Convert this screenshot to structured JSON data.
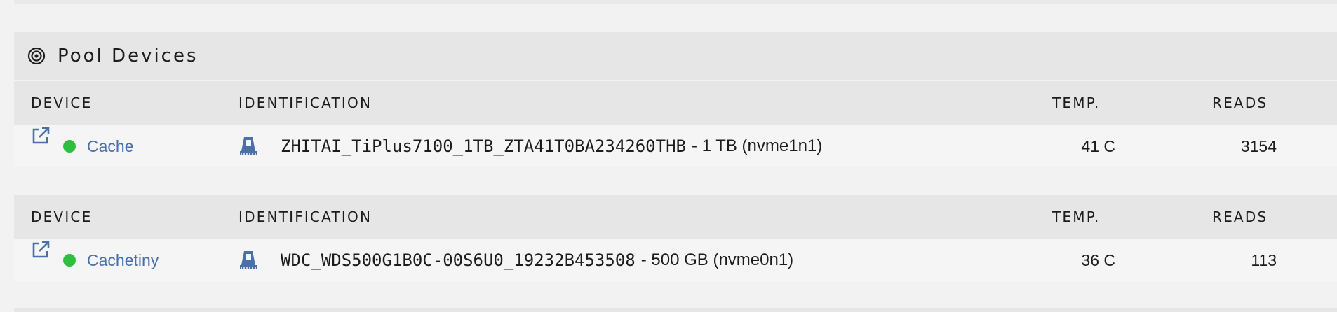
{
  "section": {
    "title": "Pool Devices",
    "icon": "target-icon"
  },
  "columns": {
    "device": "DEVICE",
    "identification": "IDENTIFICATION",
    "temp": "TEMP.",
    "reads": "READS"
  },
  "devices": [
    {
      "name": "Cache",
      "status_color": "#2fbf3f",
      "model": "ZHITAI_TiPlus7100_1TB_ZTA41T0BA234260THB",
      "extra": "- 1 TB (nvme1n1)",
      "temp": "41 C",
      "reads": "3154"
    },
    {
      "name": "Cachetiny",
      "status_color": "#2fbf3f",
      "model": "WDC_WDS500G1B0C-00S6U0_19232B453508",
      "extra": "- 500 GB (nvme0n1)",
      "temp": "36 C",
      "reads": "113"
    }
  ],
  "colors": {
    "link": "#4a70a8",
    "header_bg": "#e6e6e6",
    "row_bg": "#f5f5f5",
    "page_bg": "#f2f2f2"
  }
}
